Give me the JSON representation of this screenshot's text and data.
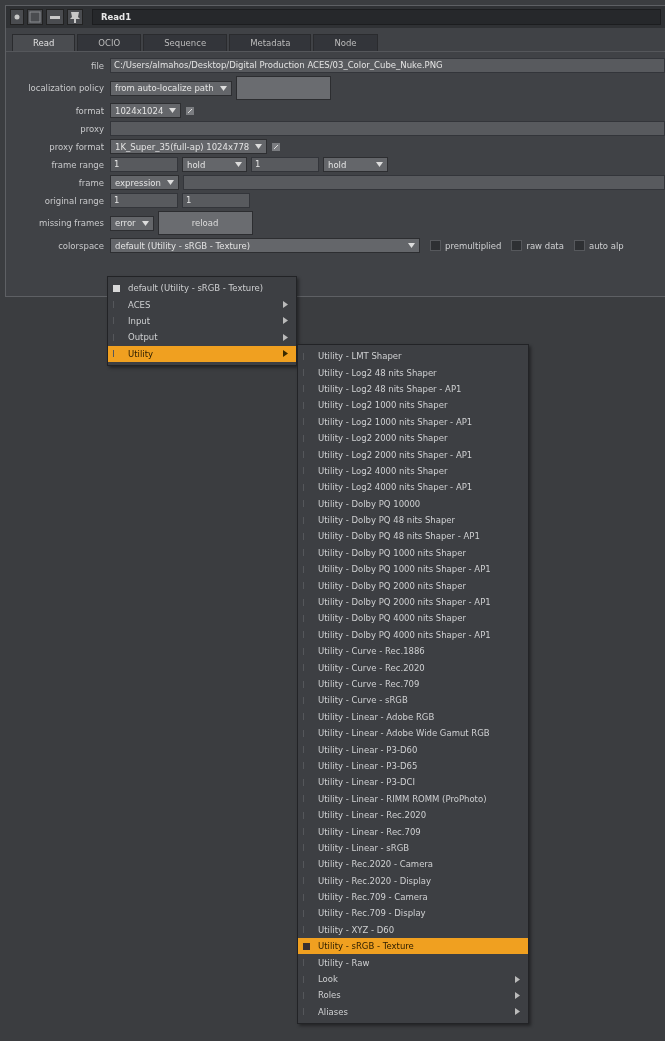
{
  "window": {
    "title": "Read1"
  },
  "tabs": [
    {
      "label": "Read",
      "selected": true
    },
    {
      "label": "OCIO",
      "selected": false
    },
    {
      "label": "Sequence",
      "selected": false
    },
    {
      "label": "Metadata",
      "selected": false
    },
    {
      "label": "Node",
      "selected": false
    }
  ],
  "knobs": [
    {
      "label": "file",
      "kind": "text",
      "value": "C:/Users/almahos/Desktop/Digital Production ACES/03_Color_Cube_Nuke.PNG"
    },
    {
      "label": "localization policy",
      "kind": "dropdown_button",
      "value": "from auto-localize path"
    },
    {
      "label": "format",
      "kind": "dropdown_edit",
      "value": "1024x1024"
    },
    {
      "label": "proxy",
      "kind": "text"
    },
    {
      "label": "proxy format",
      "kind": "dropdown_edit",
      "value": "1K_Super_35(full-ap) 1024x778"
    },
    {
      "label": "frame range",
      "kind": "range_hold",
      "values": [
        "1",
        "1"
      ],
      "modes": [
        "hold",
        "hold"
      ]
    },
    {
      "label": "frame",
      "kind": "dropdown_text",
      "value": "expression"
    },
    {
      "label": "original range",
      "kind": "range",
      "values": [
        "1",
        "1"
      ]
    },
    {
      "label": "missing frames",
      "kind": "dropdown_button",
      "value": "error",
      "button": "reload"
    },
    {
      "label": "colorspace",
      "kind": "colorspace",
      "value": "default (Utility - sRGB - Texture)",
      "checkboxes": [
        {
          "label": "premultiplied",
          "checked": false
        },
        {
          "label": "raw data",
          "checked": false
        },
        {
          "label": "auto alp",
          "checked": false
        }
      ]
    }
  ],
  "colorspace_menu": {
    "items": [
      {
        "label": "default (Utility - sRGB - Texture)",
        "checked": true,
        "selected": false,
        "submenu": false
      },
      {
        "label": "ACES",
        "checked": false,
        "selected": false,
        "submenu": true
      },
      {
        "label": "Input",
        "checked": false,
        "selected": false,
        "submenu": true
      },
      {
        "label": "Output",
        "checked": false,
        "selected": false,
        "submenu": true
      },
      {
        "label": "Utility",
        "checked": false,
        "selected": true,
        "submenu": true
      }
    ]
  },
  "utility_menu": {
    "items": [
      {
        "label": "Utility - LMT Shaper",
        "checked": false,
        "selected": false,
        "submenu": false
      },
      {
        "label": "Utility - Log2 48 nits Shaper",
        "checked": false,
        "selected": false,
        "submenu": false
      },
      {
        "label": "Utility - Log2 48 nits Shaper - AP1",
        "checked": false,
        "selected": false,
        "submenu": false
      },
      {
        "label": "Utility - Log2 1000 nits Shaper",
        "checked": false,
        "selected": false,
        "submenu": false
      },
      {
        "label": "Utility - Log2 1000 nits Shaper - AP1",
        "checked": false,
        "selected": false,
        "submenu": false
      },
      {
        "label": "Utility - Log2 2000 nits Shaper",
        "checked": false,
        "selected": false,
        "submenu": false
      },
      {
        "label": "Utility - Log2 2000 nits Shaper - AP1",
        "checked": false,
        "selected": false,
        "submenu": false
      },
      {
        "label": "Utility - Log2 4000 nits Shaper",
        "checked": false,
        "selected": false,
        "submenu": false
      },
      {
        "label": "Utility - Log2 4000 nits Shaper - AP1",
        "checked": false,
        "selected": false,
        "submenu": false
      },
      {
        "label": "Utility - Dolby PQ 10000",
        "checked": false,
        "selected": false,
        "submenu": false
      },
      {
        "label": "Utility - Dolby PQ 48 nits Shaper",
        "checked": false,
        "selected": false,
        "submenu": false
      },
      {
        "label": "Utility - Dolby PQ 48 nits Shaper - AP1",
        "checked": false,
        "selected": false,
        "submenu": false
      },
      {
        "label": "Utility - Dolby PQ 1000 nits Shaper",
        "checked": false,
        "selected": false,
        "submenu": false
      },
      {
        "label": "Utility - Dolby PQ 1000 nits Shaper - AP1",
        "checked": false,
        "selected": false,
        "submenu": false
      },
      {
        "label": "Utility - Dolby PQ 2000 nits Shaper",
        "checked": false,
        "selected": false,
        "submenu": false
      },
      {
        "label": "Utility - Dolby PQ 2000 nits Shaper - AP1",
        "checked": false,
        "selected": false,
        "submenu": false
      },
      {
        "label": "Utility - Dolby PQ 4000 nits Shaper",
        "checked": false,
        "selected": false,
        "submenu": false
      },
      {
        "label": "Utility - Dolby PQ 4000 nits Shaper - AP1",
        "checked": false,
        "selected": false,
        "submenu": false
      },
      {
        "label": "Utility - Curve - Rec.1886",
        "checked": false,
        "selected": false,
        "submenu": false
      },
      {
        "label": "Utility - Curve - Rec.2020",
        "checked": false,
        "selected": false,
        "submenu": false
      },
      {
        "label": "Utility - Curve - Rec.709",
        "checked": false,
        "selected": false,
        "submenu": false
      },
      {
        "label": "Utility - Curve - sRGB",
        "checked": false,
        "selected": false,
        "submenu": false
      },
      {
        "label": "Utility - Linear - Adobe RGB",
        "checked": false,
        "selected": false,
        "submenu": false
      },
      {
        "label": "Utility - Linear - Adobe Wide Gamut RGB",
        "checked": false,
        "selected": false,
        "submenu": false
      },
      {
        "label": "Utility - Linear - P3-D60",
        "checked": false,
        "selected": false,
        "submenu": false
      },
      {
        "label": "Utility - Linear - P3-D65",
        "checked": false,
        "selected": false,
        "submenu": false
      },
      {
        "label": "Utility - Linear - P3-DCI",
        "checked": false,
        "selected": false,
        "submenu": false
      },
      {
        "label": "Utility - Linear - RIMM ROMM (ProPhoto)",
        "checked": false,
        "selected": false,
        "submenu": false
      },
      {
        "label": "Utility - Linear - Rec.2020",
        "checked": false,
        "selected": false,
        "submenu": false
      },
      {
        "label": "Utility - Linear - Rec.709",
        "checked": false,
        "selected": false,
        "submenu": false
      },
      {
        "label": "Utility - Linear - sRGB",
        "checked": false,
        "selected": false,
        "submenu": false
      },
      {
        "label": "Utility - Rec.2020 - Camera",
        "checked": false,
        "selected": false,
        "submenu": false
      },
      {
        "label": "Utility - Rec.2020 - Display",
        "checked": false,
        "selected": false,
        "submenu": false
      },
      {
        "label": "Utility - Rec.709 - Camera",
        "checked": false,
        "selected": false,
        "submenu": false
      },
      {
        "label": "Utility - Rec.709 - Display",
        "checked": false,
        "selected": false,
        "submenu": false
      },
      {
        "label": "Utility - XYZ - D60",
        "checked": false,
        "selected": false,
        "submenu": false
      },
      {
        "label": "Utility - sRGB - Texture",
        "checked": true,
        "selected": true,
        "submenu": false
      },
      {
        "label": "Utility - Raw",
        "checked": false,
        "selected": false,
        "submenu": false
      },
      {
        "label": "Look",
        "checked": false,
        "selected": false,
        "submenu": true
      },
      {
        "label": "Roles",
        "checked": false,
        "selected": false,
        "submenu": true
      },
      {
        "label": "Aliases",
        "checked": false,
        "selected": false,
        "submenu": true
      }
    ]
  }
}
